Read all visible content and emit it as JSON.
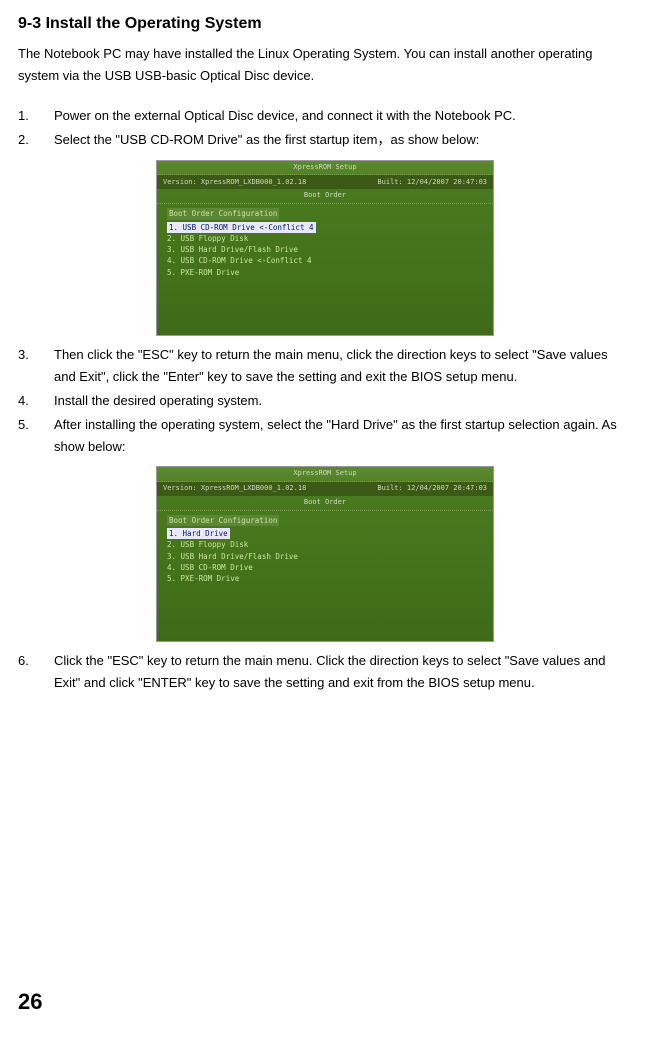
{
  "heading": "9-3 Install the Operating System",
  "intro": "The Notebook PC may have installed the Linux Operating System. You can install another operating system via the USB USB-basic Optical Disc device.",
  "steps": [
    {
      "num": "1.",
      "text": "Power on the external Optical Disc device, and connect it with the Notebook PC."
    },
    {
      "num": "2.",
      "text": "Select the \"USB CD-ROM Drive\" as the first startup item，as show below:"
    },
    {
      "num": "3.",
      "text": "Then click the \"ESC\" key to return the main menu, click the direction keys to select \"Save values and Exit\", click the \"Enter\" key to save the setting and exit the BIOS setup menu."
    },
    {
      "num": "4.",
      "text": "Install the desired operating system."
    },
    {
      "num": "5.",
      "text": "After installing the operating system, select the \"Hard Drive\" as the first startup selection again. As show below:"
    },
    {
      "num": "6.",
      "text": "Click the \"ESC\" key to return the main menu. Click the direction keys to select \"Save values and Exit\" and click \"ENTER\" key to save the setting and exit from the BIOS setup menu."
    }
  ],
  "bios1": {
    "topcenter": "XpressROM Setup",
    "version": "Version: XpressROM_LXDB000_1.02.18",
    "built": "Built: 12/04/2007 20:47:03",
    "subtitle": "Boot Order",
    "config_label": "Boot Order Configuration",
    "items": [
      "1. USB CD-ROM Drive <-Conflict 4",
      "2. USB Floppy Disk",
      "3. USB Hard Drive/Flash Drive",
      "4. USB CD-ROM Drive <-Conflict 4",
      "5. PXE-ROM Drive"
    ]
  },
  "bios2": {
    "topcenter": "XpressROM Setup",
    "version": "Version: XpressROM_LXDB000_1.02.18",
    "built": "Built: 12/04/2007 20:47:03",
    "subtitle": "Boot Order",
    "config_label": "Boot Order Configuration",
    "items": [
      "1. Hard Drive",
      "2. USB Floppy Disk",
      "3. USB Hard Drive/Flash Drive",
      "4. USB CD-ROM Drive",
      "5. PXE-ROM Drive"
    ]
  },
  "page_number": "26"
}
